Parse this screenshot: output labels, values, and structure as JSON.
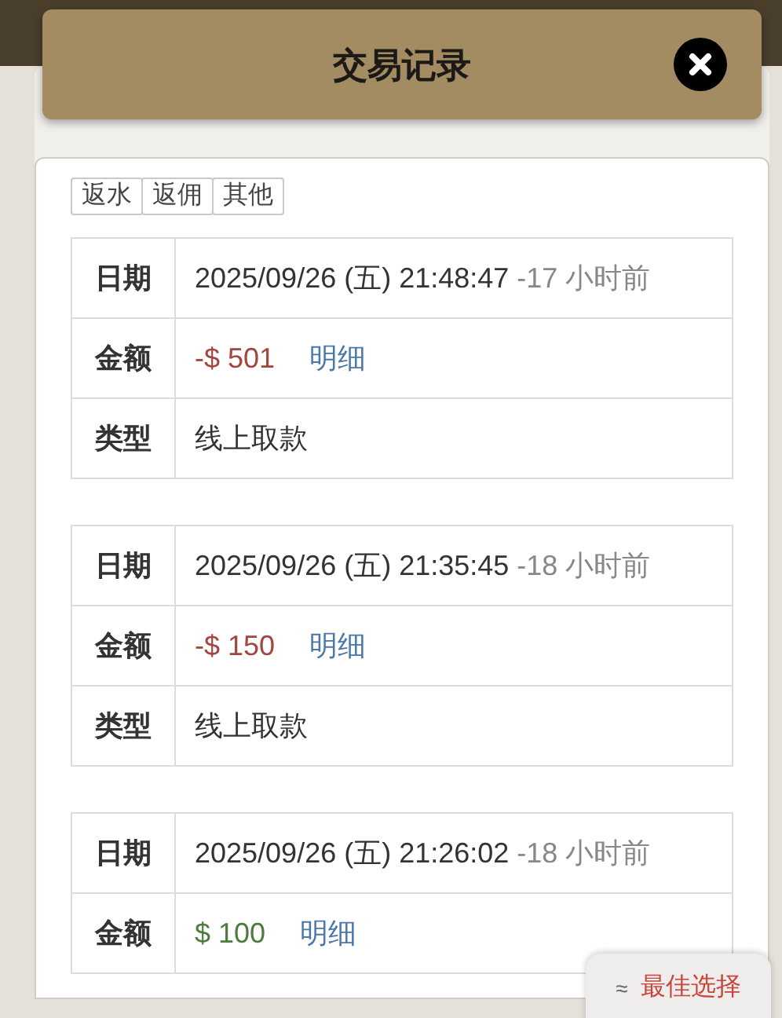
{
  "dialog": {
    "title": "交易记录"
  },
  "filters": [
    {
      "label": "返水"
    },
    {
      "label": "返佣"
    },
    {
      "label": "其他"
    }
  ],
  "records": [
    {
      "date_label": "日期",
      "date": "2025/09/26 (五) 21:48:47",
      "ago": "-17 小时前",
      "amount_label": "金额",
      "amount": "-$ 501",
      "kind": "debit",
      "detail_link": "明细",
      "type_label": "类型",
      "type": "线上取款"
    },
    {
      "date_label": "日期",
      "date": "2025/09/26 (五) 21:35:45",
      "ago": "-18 小时前",
      "amount_label": "金额",
      "amount": "-$ 150",
      "kind": "debit",
      "detail_link": "明细",
      "type_label": "类型",
      "type": "线上取款"
    },
    {
      "date_label": "日期",
      "date": "2025/09/26 (五) 21:26:02",
      "ago": "-18 小时前",
      "amount_label": "金额",
      "amount": "$ 100",
      "kind": "credit",
      "detail_link": "明细"
    }
  ],
  "best_choice_button": {
    "icon": "≈",
    "label": "最佳选择"
  }
}
